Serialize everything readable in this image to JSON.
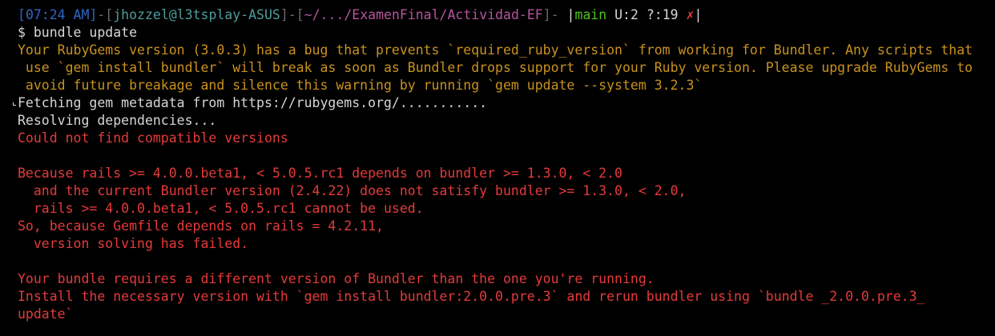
{
  "prompt": {
    "open_bracket": "[",
    "time": "07:24 AM",
    "close_bracket": "]",
    "sep1": "-[",
    "user_host": "jhozzel@l3tsplay-ASUS",
    "sep2": "]-[",
    "cwd": "~/.../ExamenFinal/Actividad-EF",
    "sep3": "]-",
    "git_open": " |",
    "branch": "main",
    "git_status": " U:2 ?:19 ",
    "git_cross": "✗",
    "git_close": "|"
  },
  "command": "$ bundle update",
  "warning_lines": [
    "Your RubyGems version (3.0.3) has a bug that prevents `required_ruby_version` from working for Bundler. Any scripts that",
    " use `gem install bundler` will break as soon as Bundler drops support for your Ruby version. Please upgrade RubyGems to",
    " avoid future breakage and silence this warning by running `gem update --system 3.2.3`"
  ],
  "info_lines": [
    "Fetching gem metadata from https://rubygems.org/...........",
    "Resolving dependencies..."
  ],
  "error_lines": [
    "Could not find compatible versions",
    "",
    "Because rails >= 4.0.0.beta1, < 5.0.5.rc1 depends on bundler >= 1.3.0, < 2.0",
    "  and the current Bundler version (2.4.22) does not satisfy bundler >= 1.3.0, < 2.0,",
    "  rails >= 4.0.0.beta1, < 5.0.5.rc1 cannot be used.",
    "So, because Gemfile depends on rails = 4.2.11,",
    "  version solving has failed.",
    "",
    "Your bundle requires a different version of Bundler than the one you're running.",
    "Install the necessary version with `gem install bundler:2.0.0.pre.3` and rerun bundler using `bundle _2.0.0.pre.3_",
    "update`"
  ],
  "colors": {
    "background": "#000000",
    "text": "#d6d6d6",
    "warning": "#c9921e",
    "error": "#e53a3a",
    "time": "#2f67c8",
    "user_host": "#4f9c9c",
    "cwd": "#b5559d",
    "branch": "#4fc21d"
  }
}
